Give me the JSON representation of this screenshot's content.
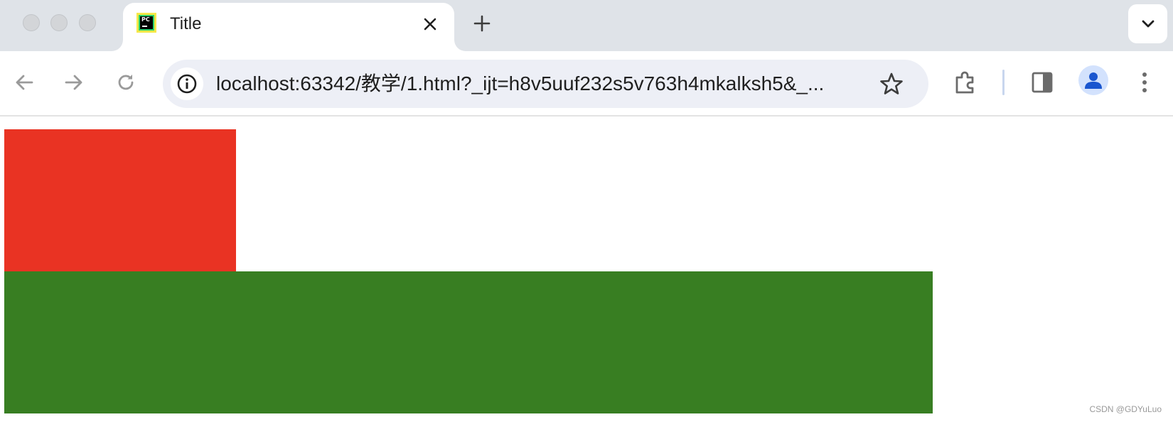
{
  "window": {
    "tab": {
      "title": "Title",
      "favicon_text": "PC",
      "favicon": "pycharm-logo-icon"
    },
    "toolbar": {
      "url": "localhost:63342/教学/1.html?_ijt=h8v5uuf232s5v763h4mkalksh5&_..."
    },
    "icons": {
      "close": "close-icon",
      "new_tab": "plus-icon",
      "tab_search": "chevron-down-icon",
      "back": "arrow-left-icon",
      "forward": "arrow-right-icon",
      "reload": "reload-icon",
      "site_info": "info-icon",
      "bookmark": "star-icon",
      "extensions": "puzzle-icon",
      "side_panel": "side-panel-icon",
      "profile": "person-icon",
      "menu": "more-vertical-icon"
    }
  },
  "page": {
    "boxes": [
      {
        "name": "red-box",
        "color": "#e93323"
      },
      {
        "name": "green-box",
        "color": "#387e22"
      }
    ],
    "watermark": "CSDN @GDYuLuo"
  },
  "colors": {
    "tabstrip": "#dfe3e8",
    "omnibox": "#edeff6",
    "avatar_bg": "#d3e2fd",
    "avatar_fg": "#1a56cf"
  }
}
